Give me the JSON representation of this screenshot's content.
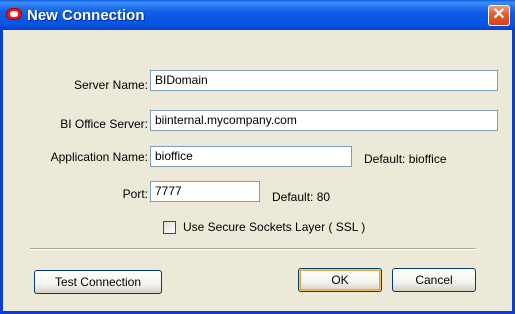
{
  "window": {
    "title": "New Connection",
    "close_symbol": "✕",
    "title_icon": "oracle-logo-icon"
  },
  "form": {
    "server_name": {
      "label": "Server Name:",
      "value": "BIDomain"
    },
    "bi_office_server": {
      "label": "BI Office Server:",
      "value": "biinternal.mycompany.com"
    },
    "application_name": {
      "label": "Application Name:",
      "value": "bioffice",
      "hint": "Default: bioffice"
    },
    "port": {
      "label": "Port:",
      "value": "7777",
      "hint": "Default: 80"
    },
    "ssl": {
      "label": "Use Secure Sockets Layer ( SSL )",
      "checked": false
    }
  },
  "buttons": {
    "test_connection": "Test Connection",
    "ok": "OK",
    "cancel": "Cancel"
  }
}
